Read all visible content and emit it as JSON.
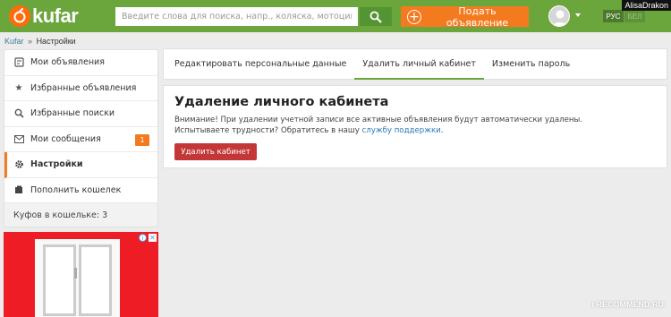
{
  "header": {
    "logo_text": "kufar",
    "search_placeholder": "Введите слова для поиска, напр., коляска, мотоцикл...",
    "post_label": "Подать объявление",
    "lang_ru": "РУС",
    "lang_be": "БЕЛ"
  },
  "watermark_user": "AlisaDrakon",
  "breadcrumb": {
    "home": "Kufar",
    "separator": "»",
    "current": "Настройки"
  },
  "sidebar": {
    "items": [
      {
        "label": "Мои объявления",
        "icon": "ads-icon"
      },
      {
        "label": "Избранные объявления",
        "icon": "star-icon"
      },
      {
        "label": "Избранные поиски",
        "icon": "search-icon"
      },
      {
        "label": "Мои сообщения",
        "icon": "mail-icon",
        "badge": "1"
      },
      {
        "label": "Настройки",
        "icon": "gear-icon",
        "active": true
      },
      {
        "label": "Пополнить кошелек",
        "icon": "wallet-icon"
      }
    ],
    "wallet_text": "Куфов в кошельке: 3"
  },
  "tabs": [
    {
      "label": "Редактировать персональные данные"
    },
    {
      "label": "Удалить личный кабинет",
      "active": true
    },
    {
      "label": "Изменить пароль"
    }
  ],
  "delete_card": {
    "title": "Удаление личного кабинета",
    "text_line1": "Внимание! При удалении учетной записи все активные объявления будут автоматически удалены.",
    "text_line2_prefix": "Испытываете трудности? Обратитесь в нашу ",
    "support_link": "службу поддержки",
    "text_line2_suffix": ".",
    "button_label": "Удалить кабинет"
  },
  "colors": {
    "header_green": "#6aa63c",
    "accent_orange": "#f47a20",
    "danger_red": "#c43737"
  }
}
